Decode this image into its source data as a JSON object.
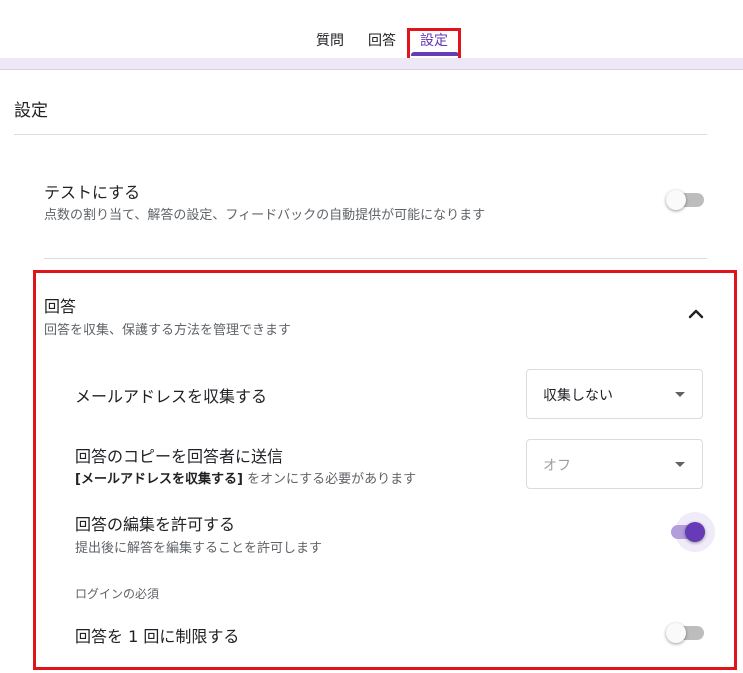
{
  "tabs": {
    "questions": "質問",
    "responses": "回答",
    "settings": "設定"
  },
  "page_title": "設定",
  "quiz": {
    "title": "テストにする",
    "description": "点数の割り当て、解答の設定、フィードバックの自動提供が可能になります",
    "enabled": false
  },
  "responses_section": {
    "title": "回答",
    "description": "回答を収集、保護する方法を管理できます",
    "expanded": true,
    "collect_email": {
      "label": "メールアドレスを収集する",
      "selected": "収集しない"
    },
    "send_copy": {
      "label": "回答のコピーを回答者に送信",
      "note_bold": "[メールアドレスを収集する]",
      "note_rest": " をオンにする必要があります",
      "selected": "オフ",
      "disabled": true
    },
    "allow_edit": {
      "label": "回答の編集を許可する",
      "description": "提出後に解答を編集することを許可します",
      "enabled": true
    },
    "login_group_label": "ログインの必須",
    "limit_one": {
      "label": "回答を 1 回に制限する",
      "enabled": false
    }
  },
  "colors": {
    "accent": "#673ab7",
    "highlight_box": "#e0141b",
    "band": "#ede7f6"
  }
}
